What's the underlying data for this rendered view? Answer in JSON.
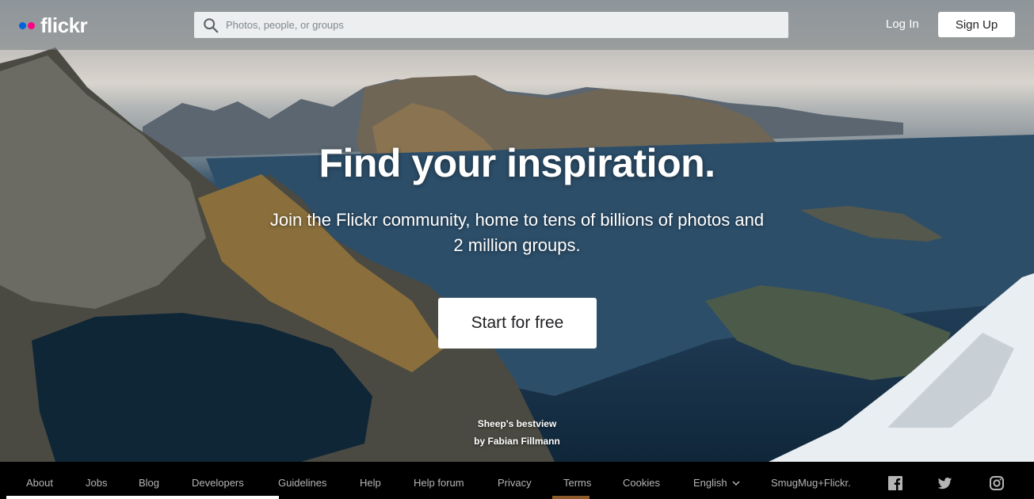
{
  "header": {
    "logo_text": "flickr",
    "search_placeholder": "Photos, people, or groups",
    "login_label": "Log In",
    "signup_label": "Sign Up"
  },
  "hero": {
    "title": "Find your inspiration.",
    "subtitle": "Join the Flickr community, home to tens of billions of photos and 2 million groups.",
    "cta_label": "Start for free",
    "credit_title": "Sheep's bestview",
    "credit_author": "by Fabian Fillmann"
  },
  "footer": {
    "links": [
      "About",
      "Jobs",
      "Blog",
      "Developers",
      "Guidelines",
      "Help",
      "Help forum",
      "Privacy",
      "Terms",
      "Cookies",
      "English",
      "SmugMug+Flickr."
    ],
    "social_icons": [
      "facebook-icon",
      "twitter-icon",
      "instagram-icon"
    ]
  },
  "colors": {
    "brand_blue": "#0063dc",
    "brand_pink": "#ff0084",
    "footer_text": "#b5b5b5"
  }
}
